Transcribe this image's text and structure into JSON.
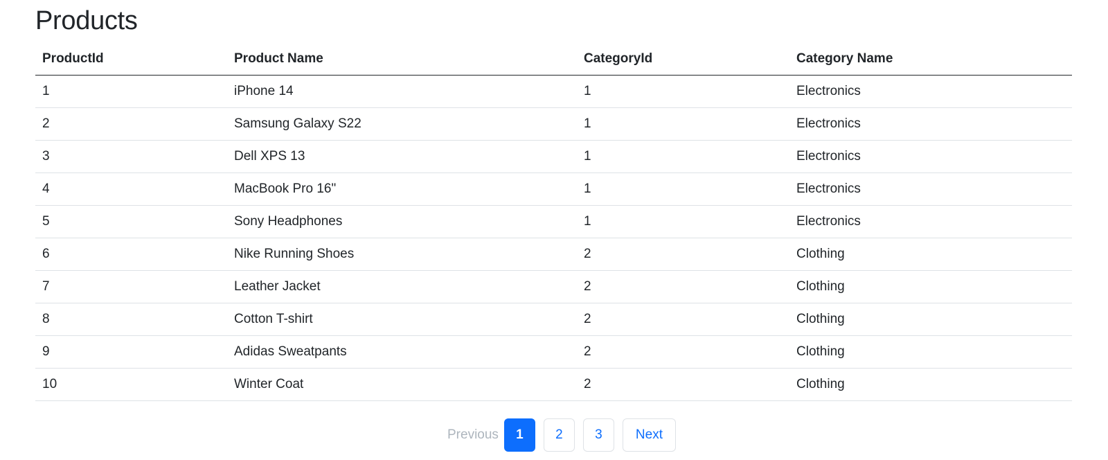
{
  "page": {
    "title": "Products"
  },
  "table": {
    "headers": {
      "product_id": "ProductId",
      "product_name": "Product Name",
      "category_id": "CategoryId",
      "category_name": "Category Name"
    },
    "rows": [
      {
        "product_id": "1",
        "product_name": "iPhone 14",
        "category_id": "1",
        "category_name": "Electronics"
      },
      {
        "product_id": "2",
        "product_name": "Samsung Galaxy S22",
        "category_id": "1",
        "category_name": "Electronics"
      },
      {
        "product_id": "3",
        "product_name": "Dell XPS 13",
        "category_id": "1",
        "category_name": "Electronics"
      },
      {
        "product_id": "4",
        "product_name": "MacBook Pro 16\"",
        "category_id": "1",
        "category_name": "Electronics"
      },
      {
        "product_id": "5",
        "product_name": "Sony Headphones",
        "category_id": "1",
        "category_name": "Electronics"
      },
      {
        "product_id": "6",
        "product_name": "Nike Running Shoes",
        "category_id": "2",
        "category_name": "Clothing"
      },
      {
        "product_id": "7",
        "product_name": "Leather Jacket",
        "category_id": "2",
        "category_name": "Clothing"
      },
      {
        "product_id": "8",
        "product_name": "Cotton T-shirt",
        "category_id": "2",
        "category_name": "Clothing"
      },
      {
        "product_id": "9",
        "product_name": "Adidas Sweatpants",
        "category_id": "2",
        "category_name": "Clothing"
      },
      {
        "product_id": "10",
        "product_name": "Winter Coat",
        "category_id": "2",
        "category_name": "Clothing"
      }
    ]
  },
  "pagination": {
    "previous_label": "Previous",
    "pages": [
      "1",
      "2",
      "3"
    ],
    "current_page": "1",
    "next_label": "Next"
  },
  "colors": {
    "accent": "#0d6efd",
    "text": "#212529",
    "disabled": "#adb5bd",
    "row_border": "#dee2e6"
  }
}
